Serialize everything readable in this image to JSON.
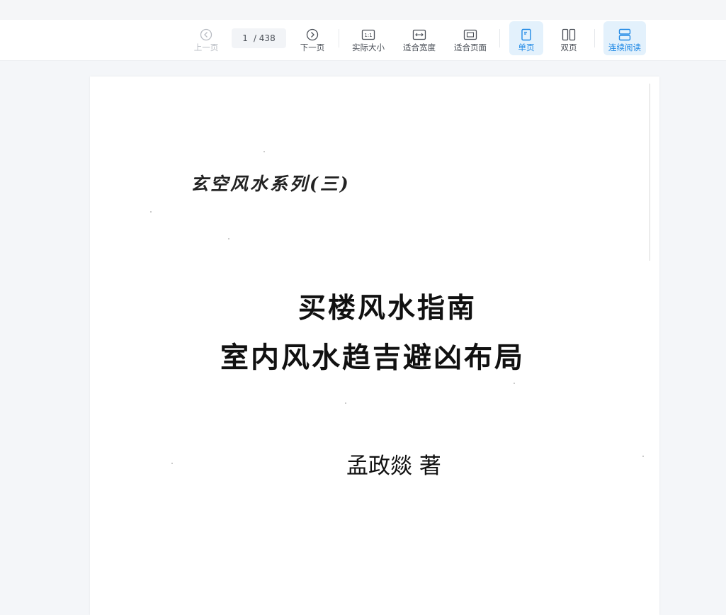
{
  "toolbar": {
    "prev_label": "上一页",
    "next_label": "下一页",
    "current_page": "1",
    "total_pages": "/ 438",
    "actual_size_label": "实际大小",
    "fit_width_label": "适合宽度",
    "fit_page_label": "适合页面",
    "single_page_label": "单页",
    "double_page_label": "双页",
    "continuous_label": "连续阅读",
    "actual_size_icon_text": "1:1",
    "accent_color": "#1e88e5",
    "disabled_color": "#b8bcc3"
  },
  "document": {
    "series": "玄空风水系列(三)",
    "title_line1": "买楼风水指南",
    "title_line2": "室内风水趋吉避凶布局",
    "author": "孟政燚 著"
  }
}
